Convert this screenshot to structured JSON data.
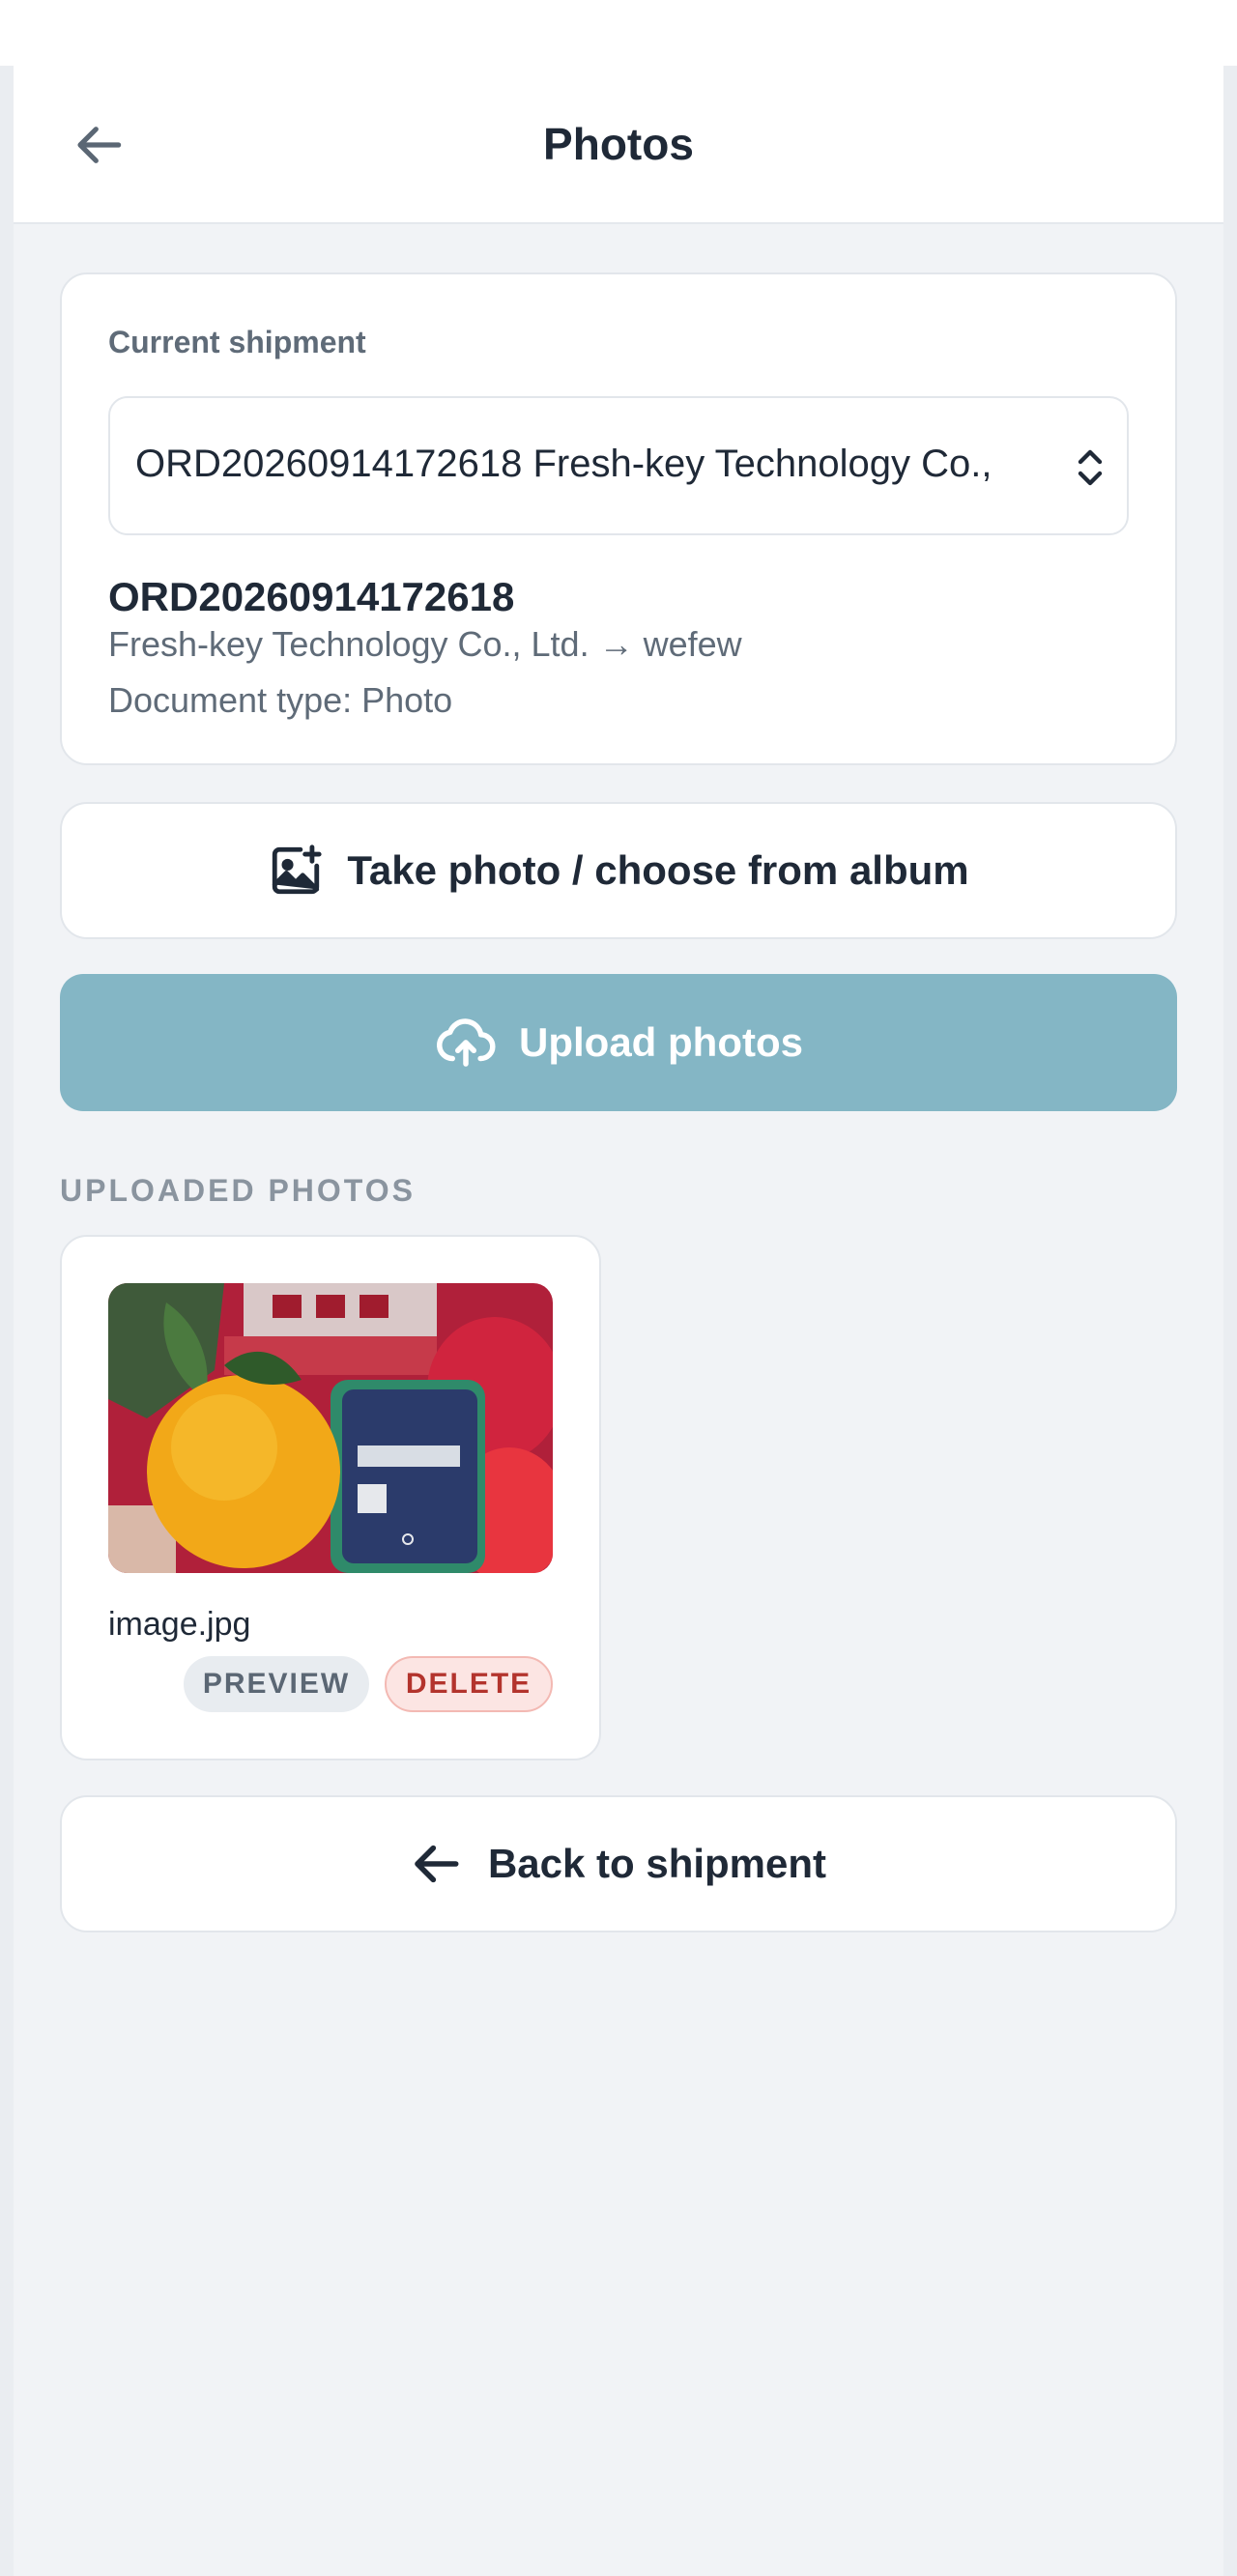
{
  "header": {
    "title": "Photos",
    "back_icon": "arrow-left-icon"
  },
  "shipment": {
    "label": "Current shipment",
    "select_value": "ORD20260914172618 Fresh-key Technology Co.,",
    "order_id": "ORD20260914172618",
    "route": "Fresh-key Technology Co., Ltd. → wefew",
    "document_type": "Document type: Photo"
  },
  "actions": {
    "take_photo_label": "Take photo / choose from album",
    "take_photo_icon": "image-add-icon",
    "upload_label": "Upload photos",
    "upload_icon": "cloud-upload-icon",
    "upload_color": "#84b6c5"
  },
  "uploaded": {
    "section_title": "UPLOADED PHOTOS",
    "photos": [
      {
        "file_name": "image.jpg",
        "preview_label": "PREVIEW",
        "delete_label": "DELETE"
      }
    ]
  },
  "footer": {
    "back_label": "Back to shipment",
    "back_icon": "arrow-left-icon"
  }
}
